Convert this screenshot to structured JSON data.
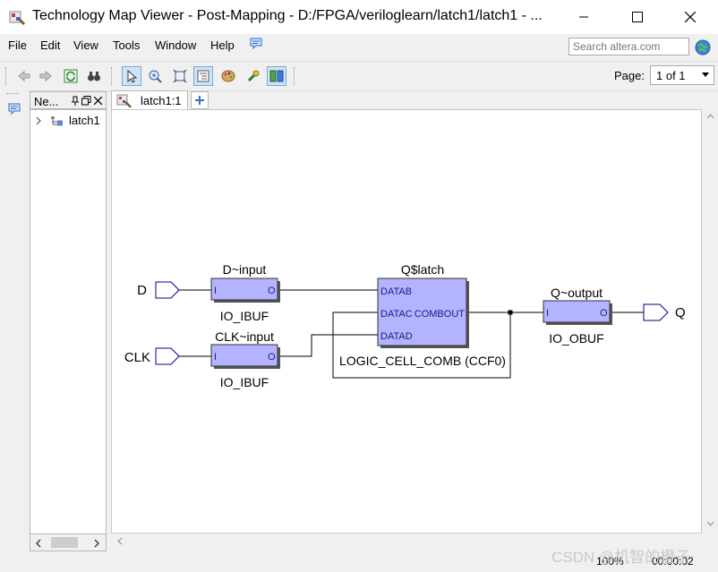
{
  "window": {
    "title": "Technology Map Viewer - Post-Mapping - D:/FPGA/veriloglearn/latch1/latch1 - ..."
  },
  "menu": {
    "items": [
      {
        "label": "File"
      },
      {
        "label": "Edit"
      },
      {
        "label": "View"
      },
      {
        "label": "Tools"
      },
      {
        "label": "Window"
      },
      {
        "label": "Help"
      }
    ],
    "search_placeholder": "Search altera.com"
  },
  "toolbar": {
    "page_label": "Page:",
    "page_value": "1 of 1"
  },
  "nav": {
    "header": "Ne...",
    "tree_item": "latch1"
  },
  "tabs": {
    "active": "latch1:1"
  },
  "schematic": {
    "ports": {
      "input_d": "D",
      "input_clk": "CLK",
      "output_q": "Q"
    },
    "d_input": {
      "name": "D~input",
      "type": "IO_IBUF",
      "pin_i": "I",
      "pin_o": "O"
    },
    "clk_input": {
      "name": "CLK~input",
      "type": "IO_IBUF",
      "pin_i": "I",
      "pin_o": "O"
    },
    "latch": {
      "name": "Q$latch",
      "type": "LOGIC_CELL_COMB (CCF0)",
      "pin_datab": "DATAB",
      "pin_datac": "DATAC",
      "pin_combout": "COMBOUT",
      "pin_datad": "DATAD"
    },
    "q_output": {
      "name": "Q~output",
      "type": "IO_OBUF",
      "pin_i": "I",
      "pin_o": "O"
    },
    "colors": {
      "block_fill": "#b3b3ff",
      "port_stroke": "#00008b",
      "wire": "#000000"
    }
  },
  "status": {
    "zoom": "100%",
    "time": "00:00:02"
  },
  "watermark": "CSDN @机智的橙子"
}
